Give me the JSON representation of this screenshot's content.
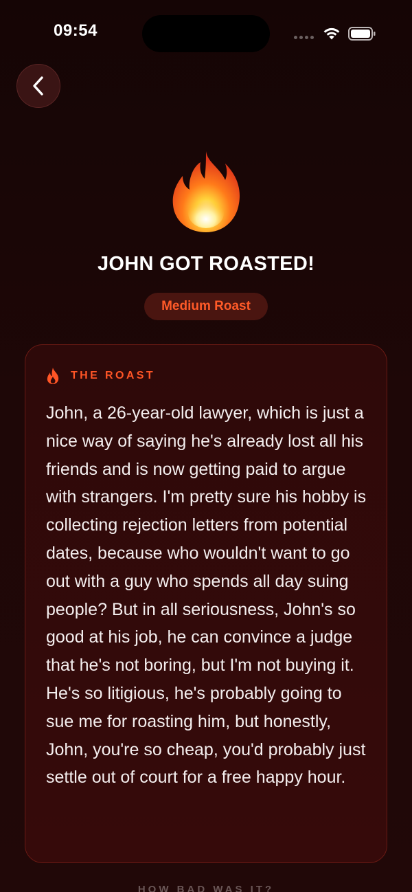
{
  "status_bar": {
    "time": "09:54"
  },
  "icons": {
    "back": "chevron-left-icon",
    "hero": "fire-emoji",
    "card": "flame-icon"
  },
  "header": {
    "title": "JOHN GOT ROASTED!",
    "badge": "Medium Roast"
  },
  "roast_card": {
    "label": "THE ROAST",
    "text": "John, a 26-year-old lawyer, which is just a nice way of saying he's already lost all his friends and is now getting paid to argue with strangers. I'm pretty sure his hobby is collecting rejection letters from potential dates, because who wouldn't want to go out with a guy who spends all day suing people? But in all seriousness, John's so good at his job, he can convince a judge that he's not boring, but I'm not buying it. He's so litigious, he's probably going to sue me for roasting him, but honestly, John, you're so cheap, you'd probably just settle out of court for a free happy hour."
  },
  "rating": {
    "heading": "HOW BAD WAS IT?"
  },
  "colors": {
    "background": "#1a0606",
    "accent": "#ff5526",
    "card_border": "#6a1a14",
    "badge_bg": "#4a1510"
  }
}
